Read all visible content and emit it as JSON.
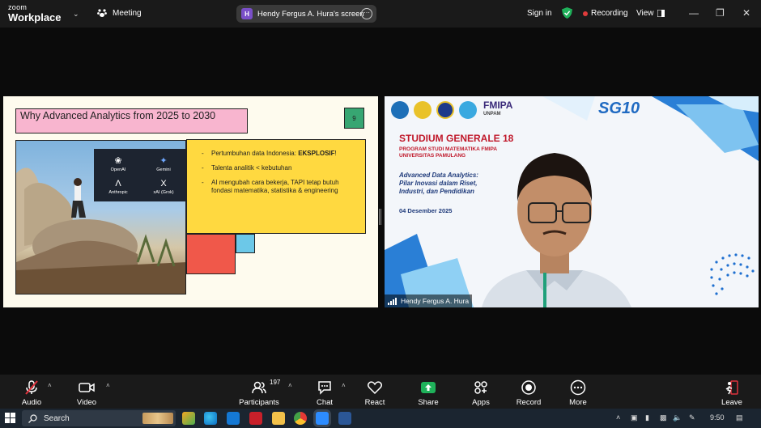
{
  "topbar": {
    "brand_line1": "zoom",
    "brand_line2": "Workplace",
    "meeting_label": "Meeting",
    "share_avatar_letter": "H",
    "share_label": "Hendy Fergus A. Hura's screen",
    "signin_label": "Sign in",
    "recording_label": "Recording",
    "view_label": "View"
  },
  "slide": {
    "title": "Why Advanced Analytics from 2025 to 2030",
    "page_number": "9",
    "ai_logos": [
      {
        "label": "OpenAI",
        "icon": "openai-icon"
      },
      {
        "label": "Gemini",
        "icon": "gemini-icon"
      },
      {
        "label": "Anthropic",
        "icon": "anthropic-icon"
      },
      {
        "label": "xAI (Grok)",
        "icon": "xai-icon"
      }
    ],
    "bullets": [
      {
        "text": "Pertumbuhan data Indonesia: ",
        "bold": "EKSPLOSIF",
        "suffix": "!"
      },
      {
        "text": "Talenta analitik < kebutuhan",
        "bold": "",
        "suffix": ""
      },
      {
        "text": "AI mengubah cara bekerja, TAPI tetap butuh fondasi matematika, statistika & engineering",
        "bold": "",
        "suffix": ""
      }
    ]
  },
  "video": {
    "fmipa": "FMIPA",
    "fmipa_sub": "UNPAM",
    "sg_logo": "SG10",
    "title": "STUDIUM GENERALE 18",
    "sub1": "PROGRAM STUDI MATEMATIKA FMIPA",
    "sub2": "UNIVERSITAS PAMULANG",
    "topic1": "Advanced Data Analytics:",
    "topic2": "Pilar Inovasi dalam Riset,",
    "topic3": "Industri, dan Pendidikan",
    "date": "04 Desember 2025",
    "participant_name": "Hendy Fergus A. Hura"
  },
  "toolbar": {
    "audio": "Audio",
    "video": "Video",
    "participants": "Participants",
    "participants_count": "197",
    "chat": "Chat",
    "react": "React",
    "share": "Share",
    "apps": "Apps",
    "record": "Record",
    "more": "More",
    "leave": "Leave"
  },
  "taskbar": {
    "search_placeholder": "Search",
    "time": "9:50"
  },
  "colors": {
    "share_green": "#1fb15a",
    "leave_red": "#e0323c",
    "slide_pink": "#f8b5cf",
    "slide_yellow": "#ffd940",
    "slide_green": "#37a672"
  }
}
